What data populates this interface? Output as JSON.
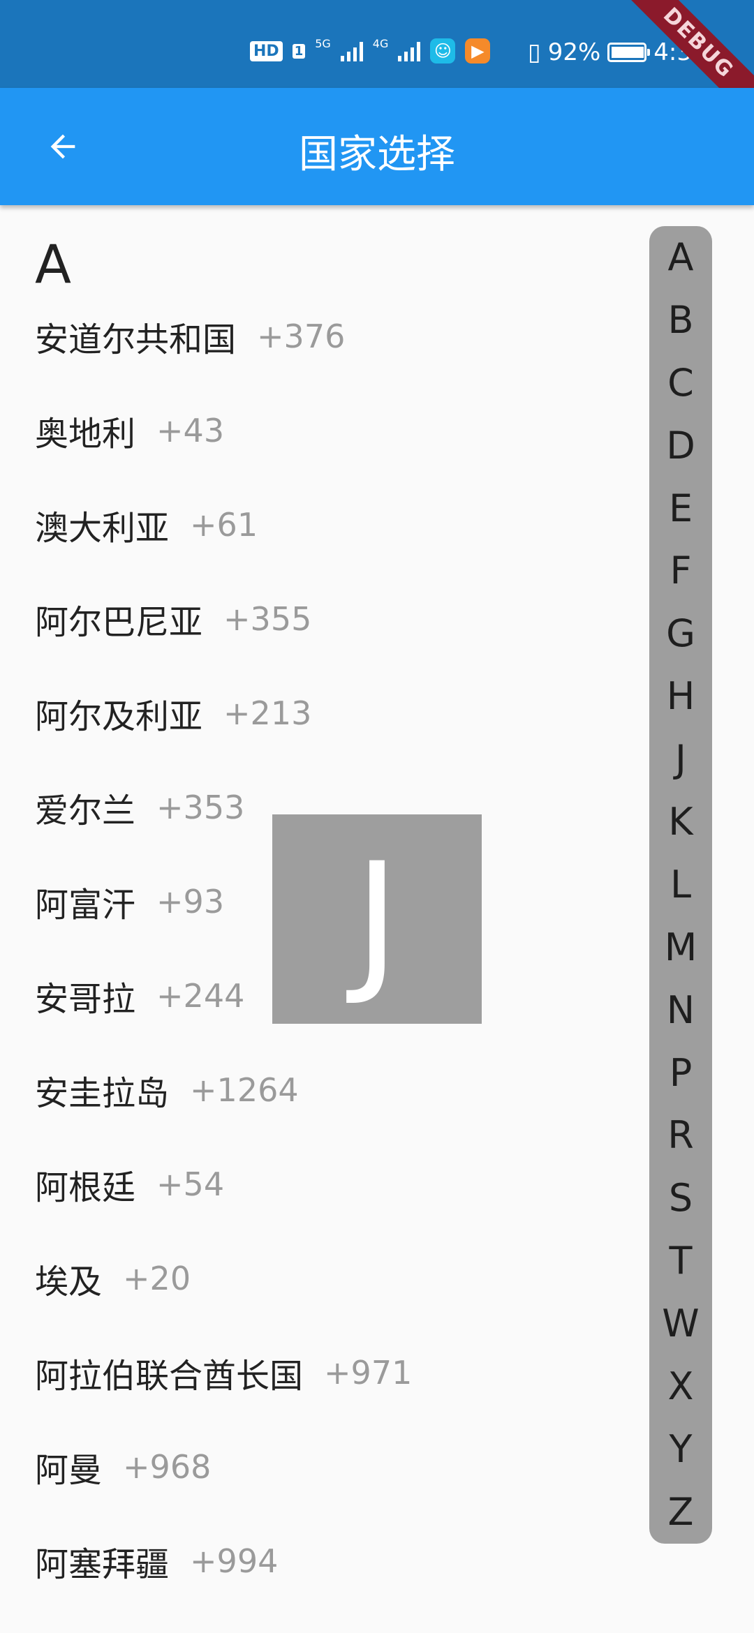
{
  "status_bar": {
    "hd": "HD",
    "sim": "1",
    "net1": "5G",
    "net2": "4G",
    "battery": "92%",
    "battery_level": 0.92,
    "time": "4:30",
    "debug": "DEBUG"
  },
  "appbar": {
    "title": "国家选择",
    "back_icon": "arrow-left-icon"
  },
  "list": {
    "section": "A",
    "items": [
      {
        "name": "安道尔共和国",
        "code": "+376"
      },
      {
        "name": "奥地利",
        "code": "+43"
      },
      {
        "name": "澳大利亚",
        "code": "+61"
      },
      {
        "name": "阿尔巴尼亚",
        "code": "+355"
      },
      {
        "name": "阿尔及利亚",
        "code": "+213"
      },
      {
        "name": "爱尔兰",
        "code": "+353"
      },
      {
        "name": "阿富汗",
        "code": "+93"
      },
      {
        "name": "安哥拉",
        "code": "+244"
      },
      {
        "name": "安圭拉岛",
        "code": "+1264"
      },
      {
        "name": "阿根廷",
        "code": "+54"
      },
      {
        "name": "埃及",
        "code": "+20"
      },
      {
        "name": "阿拉伯联合酋长国",
        "code": "+971"
      },
      {
        "name": "阿曼",
        "code": "+968"
      },
      {
        "name": "阿塞拜疆",
        "code": "+994"
      }
    ]
  },
  "index": {
    "letters": [
      "A",
      "B",
      "C",
      "D",
      "E",
      "F",
      "G",
      "H",
      "J",
      "K",
      "L",
      "M",
      "N",
      "P",
      "R",
      "S",
      "T",
      "W",
      "X",
      "Y",
      "Z"
    ]
  },
  "overlay": {
    "letter": "J"
  }
}
